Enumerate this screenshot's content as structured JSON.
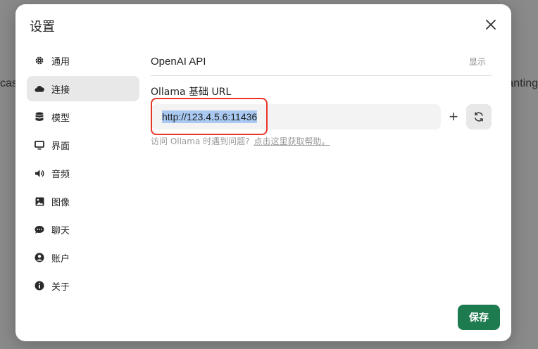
{
  "background": {
    "left_text": "cas",
    "right_text": "anting"
  },
  "modal": {
    "title": "设置",
    "close_icon": "close-icon"
  },
  "sidebar": {
    "items": [
      {
        "label": "通用",
        "icon": "gear-icon"
      },
      {
        "label": "连接",
        "icon": "cloud-icon",
        "active": true
      },
      {
        "label": "模型",
        "icon": "database-icon"
      },
      {
        "label": "界面",
        "icon": "monitor-icon"
      },
      {
        "label": "音频",
        "icon": "speaker-icon"
      },
      {
        "label": "图像",
        "icon": "image-icon"
      },
      {
        "label": "聊天",
        "icon": "chat-icon"
      },
      {
        "label": "账户",
        "icon": "user-icon"
      },
      {
        "label": "关于",
        "icon": "info-icon"
      }
    ]
  },
  "content": {
    "openai_title": "OpenAI API",
    "show_label": "显示",
    "ollama_label": "Ollama 基础 URL",
    "ollama_url": "http://123.4.5.6:11436",
    "plus_label": "+",
    "help_text": "访问 Ollama 时遇到问题?",
    "help_link": "点击这里获取帮助。"
  },
  "footer": {
    "save_label": "保存"
  },
  "colors": {
    "accent": "#1e7a4f",
    "highlight": "#e8362a",
    "selection": "#a9c9f3"
  }
}
